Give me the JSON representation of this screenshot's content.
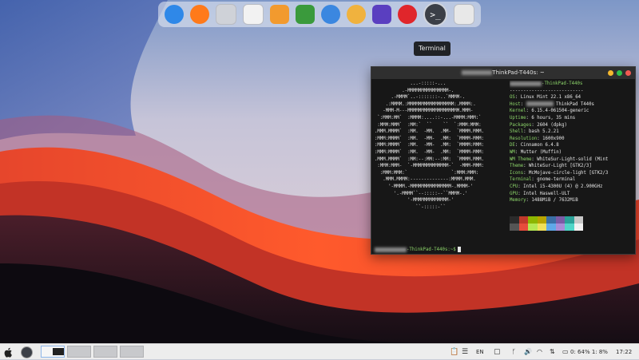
{
  "dock": {
    "items": [
      {
        "name": "finder",
        "color": "#2f88e8"
      },
      {
        "name": "firefox",
        "color": "#ff7a1a"
      },
      {
        "name": "drive",
        "color": "#cfd2d8"
      },
      {
        "name": "files",
        "color": "#f2f2f2"
      },
      {
        "name": "butterfly",
        "color": "#f29a2e"
      },
      {
        "name": "game",
        "color": "#3a9a3c"
      },
      {
        "name": "sync",
        "color": "#3b87e0"
      },
      {
        "name": "hexchat",
        "color": "#f0b23e"
      },
      {
        "name": "gitkraken",
        "color": "#5a3fc0"
      },
      {
        "name": "downloader",
        "color": "#e0262b"
      },
      {
        "name": "terminal",
        "color": "#3b3f47"
      },
      {
        "name": "trash",
        "color": "#e8e8e8"
      }
    ],
    "terminal_glyph": ">_"
  },
  "tooltip": "Terminal",
  "terminal": {
    "title": "ThinkPad-T440s: ~",
    "ascii_art": "             ...-:::::-...\n          .-MMMMMMMMMMMMMMM-.\n      .-MMMM`..-:::::::-..`MMMM-.\n    .:MMMM.:MMMMMMMMMMMMMMMMM:.MMMM:.\n   -MMM-M---MMMMMMMMMMMMMMMMMMM.MMM-\n `:MMM:MM`  :MMMM:....::-...-MMMM:MMM:`\n :MMM:MMM`  :MM:`  ``    ``  `:MMM:MMM:\n.MMM.MMMM`  :MM.  -MM.  .MM-  `MMMM.MMM.\n:MMM:MMMM`  :MM.  -MM-  .MM:  `MMMM-MMM:\n:MMM:MMMM`  :MM.  -MM-  .MM:  `MMMM:MMM:\n:MMM:MMMM`  :MM.  -MM-  .MM:  `MMMM-MMM:\n.MMM.MMMM`  :MM:--:MM:--:MM:  `MMMM.MMM.\n :MMM:MMM-  `-MMMMMMMMMMMMM-`  -MMM-MMM:\n  :MMM:MMM:`                `:MMM:MMM:\n   .MMM.MMMM:--------------:MMMM.MMM.\n     '-MMMM.-MMMMMMMMMMMMMMM-.MMMM-'\n       '.-MMMM``--:::::--``MMMM-.'\n            '-MMMMMMMMMMMMM-'\n               ``-:::::-``",
    "host_label": "ThinkPad-T440s",
    "separator": "---------------------------",
    "info": [
      {
        "k": "OS",
        "v": "Linux Mint 22.1 x86_64"
      },
      {
        "k": "Host",
        "v": "ThinkPad T440s"
      },
      {
        "k": "Kernel",
        "v": "6.15.4-061504-generic"
      },
      {
        "k": "Uptime",
        "v": "6 hours, 35 mins"
      },
      {
        "k": "Packages",
        "v": "2604 (dpkg)"
      },
      {
        "k": "Shell",
        "v": "bash 5.2.21"
      },
      {
        "k": "Resolution",
        "v": "1600x900"
      },
      {
        "k": "DE",
        "v": "Cinnamon 6.4.8"
      },
      {
        "k": "WM",
        "v": "Mutter (Muffin)"
      },
      {
        "k": "WM Theme",
        "v": "WhiteSur-Light-solid (Mint"
      },
      {
        "k": "Theme",
        "v": "WhiteSur-Light [GTK2/3]"
      },
      {
        "k": "Icons",
        "v": "McMojave-circle-light [GTK2/3"
      },
      {
        "k": "Terminal",
        "v": "gnome-terminal"
      },
      {
        "k": "CPU",
        "v": "Intel i5-4300U (4) @ 2.900GHz"
      },
      {
        "k": "GPU",
        "v": "Intel Haswell-ULT"
      },
      {
        "k": "Memory",
        "v": "1488MiB / 7632MiB"
      }
    ],
    "palette_top": [
      "#2b2b2b",
      "#c0392b",
      "#8db600",
      "#b8a400",
      "#3a6ea5",
      "#7b5ba6",
      "#2aa198",
      "#c8c8c8"
    ],
    "palette_bottom": [
      "#555555",
      "#e74c3c",
      "#b5e853",
      "#f1e05a",
      "#5fa8e8",
      "#a98bd6",
      "#4fd6c8",
      "#f2f2f2"
    ],
    "prompt": "-ThinkPad-T440s:~$"
  },
  "taskbar": {
    "lang": "EN",
    "battery": "0: 64% 1: 8%",
    "clock": "17:22"
  }
}
